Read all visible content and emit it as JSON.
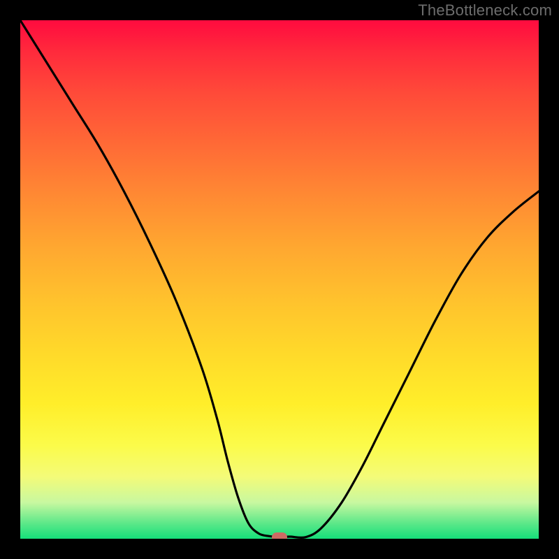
{
  "watermark": "TheBottleneck.com",
  "marker": {
    "color": "#cd6b63"
  },
  "chart_data": {
    "type": "line",
    "title": "",
    "xlabel": "",
    "ylabel": "",
    "xlim": [
      0,
      100
    ],
    "ylim": [
      0,
      100
    ],
    "grid": false,
    "legend": false,
    "series": [
      {
        "name": "curve",
        "x": [
          0,
          5,
          10,
          15,
          20,
          25,
          30,
          35,
          38,
          40,
          42,
          44,
          46,
          48,
          50,
          52,
          55,
          58,
          62,
          66,
          70,
          75,
          80,
          85,
          90,
          95,
          100
        ],
        "values": [
          100,
          92,
          84,
          76,
          67,
          57,
          46,
          33,
          23,
          15,
          8,
          3,
          1,
          0.5,
          0.3,
          0.4,
          0.3,
          2,
          7,
          14,
          22,
          32,
          42,
          51,
          58,
          63,
          67
        ]
      }
    ],
    "optimum_marker": {
      "x": 50,
      "y": 0.3
    },
    "background_gradient": {
      "direction": "top-to-bottom",
      "stops": [
        {
          "pos": 0,
          "color": "#ff0b3f"
        },
        {
          "pos": 25,
          "color": "#ff6a36"
        },
        {
          "pos": 50,
          "color": "#ffb82e"
        },
        {
          "pos": 75,
          "color": "#fff22a"
        },
        {
          "pos": 92,
          "color": "#d8fb90"
        },
        {
          "pos": 100,
          "color": "#15df7a"
        }
      ]
    }
  }
}
